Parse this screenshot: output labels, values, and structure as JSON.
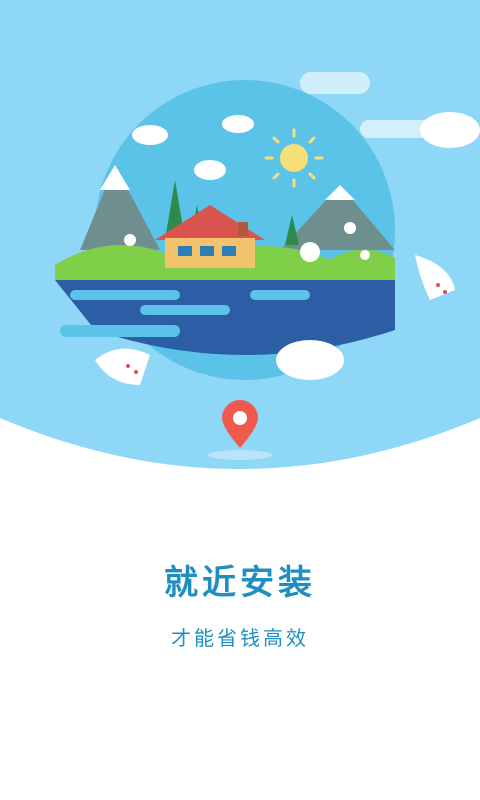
{
  "splash": {
    "title": "就近安装",
    "subtitle": "才能省钱高效"
  },
  "colors": {
    "sky": "#8ed7f6",
    "circle": "#5cc3e8",
    "accent": "#1f8fc2",
    "pin": "#ef5a4c"
  },
  "icons": [
    "cloud-icon",
    "sun-icon",
    "location-pin-icon",
    "house-icon",
    "sheep-icon",
    "tree-icon",
    "mountain-icon"
  ]
}
